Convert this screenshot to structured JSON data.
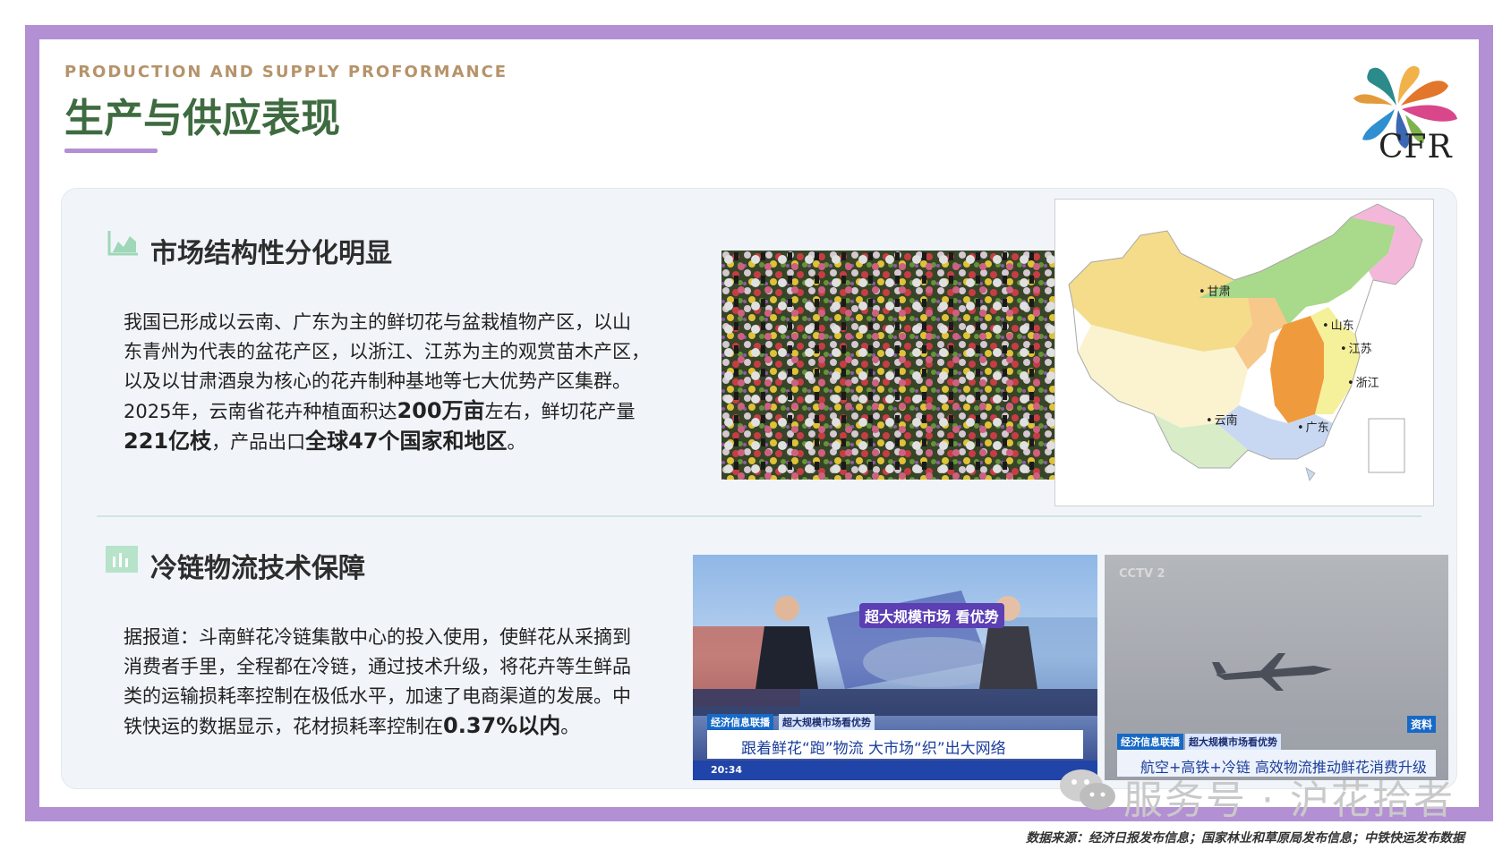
{
  "header": {
    "subtitle": "PRODUCTION AND SUPPLY PROFORMANCE",
    "title": "生产与供应表现"
  },
  "logo": {
    "text": "CFR"
  },
  "section1": {
    "title": "市场结构性分化明显",
    "icon": "area-chart-icon",
    "para_line1": "我国已形成以云南、广东为主的鲜切花与盆栽植物产区，以山",
    "para_line2": "东青州为代表的盆花产区，以浙江、江苏为主的观赏苗木产区，",
    "para_line3": "以及以甘肃酒泉为核心的花卉制种基地等七大优势产区集群。",
    "para_line4_a": "2025年，云南省花卉种植面积达",
    "para_line4_b": "200万亩",
    "para_line4_c": "左右，鲜切花产量",
    "para_line5_a": "221亿枝",
    "para_line5_b": "，产品出口",
    "para_line5_c": "全球47个国家和地区",
    "para_line5_d": "。"
  },
  "map": {
    "labels": {
      "gansu": "甘肃",
      "shandong": "山东",
      "jiangsu": "江苏",
      "zhejiang": "浙江",
      "yunnan": "云南",
      "guangdong": "广东"
    }
  },
  "section2": {
    "title": "冷链物流技术保障",
    "icon": "bar-chart-icon",
    "para_line1": "据报道：斗南鲜花冷链集散中心的投入使用，使鲜花从采摘到",
    "para_line2": "消费者手里，全程都在冷链，通过技术升级，将花卉等生鲜品",
    "para_line3": "类的运输损耗率控制在极低水平，加速了电商渠道的发展。中",
    "para_line4_a": "铁快运的数据显示，花材损耗率控制在",
    "para_line4_b": "0.37%以内",
    "para_line4_c": "。"
  },
  "tv1": {
    "banner": "超大规模市场 看优势",
    "tag1": "经济信息联播",
    "tag2": "超大规模市场看优势",
    "caption": "跟着鲜花“跑”物流 大市场“织”出大网络",
    "time": "20:34"
  },
  "tv2": {
    "channel": "CCTV 2",
    "tag1": "经济信息联播",
    "tag2": "超大规模市场看优势",
    "badge": "资料",
    "caption": "航空+高铁+冷链 高效物流推动鲜花消费升级"
  },
  "watermark": {
    "text": "服务号 · 沪花拾者"
  },
  "footer": {
    "source": "数据来源：经济日报发布信息；国家林业和草原局发布信息；中铁快运发布数据"
  },
  "colors": {
    "frame": "#b38fd3",
    "title_green": "#3e6b3f",
    "subtitle_gold": "#b6936a",
    "panel_bg": "#f1f5f9",
    "section_icon": "#9fd7b8"
  }
}
